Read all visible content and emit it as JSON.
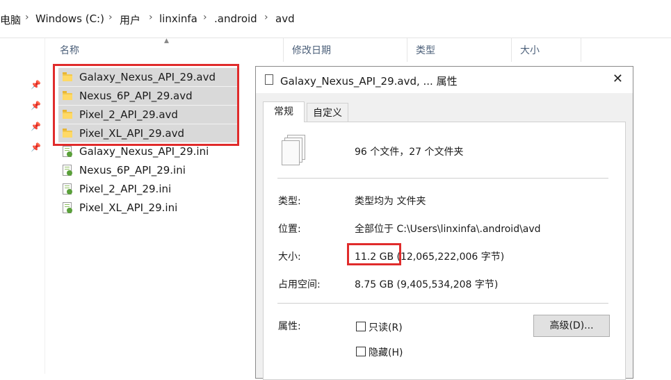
{
  "breadcrumb": [
    "电脑",
    "Windows (C:)",
    "用户",
    "linxinfa",
    ".android",
    "avd"
  ],
  "columns": {
    "name": "名称",
    "modified": "修改日期",
    "type": "类型",
    "size": "大小"
  },
  "files": [
    {
      "name": "Galaxy_Nexus_API_29.avd",
      "kind": "folder",
      "selected": true
    },
    {
      "name": "Nexus_6P_API_29.avd",
      "kind": "folder",
      "selected": true
    },
    {
      "name": "Pixel_2_API_29.avd",
      "kind": "folder",
      "selected": true
    },
    {
      "name": "Pixel_XL_API_29.avd",
      "kind": "folder",
      "selected": true
    },
    {
      "name": "Galaxy_Nexus_API_29.ini",
      "kind": "ini",
      "selected": false
    },
    {
      "name": "Nexus_6P_API_29.ini",
      "kind": "ini",
      "selected": false
    },
    {
      "name": "Pixel_2_API_29.ini",
      "kind": "ini",
      "selected": false
    },
    {
      "name": "Pixel_XL_API_29.ini",
      "kind": "ini",
      "selected": false
    }
  ],
  "dialog": {
    "title": "Galaxy_Nexus_API_29.avd, ... 属性",
    "tabs": [
      "常规",
      "自定义"
    ],
    "summary": "96 个文件，27 个文件夹",
    "type_label": "类型:",
    "type_value": "类型均为 文件夹",
    "location_label": "位置:",
    "location_value": "全部位于 C:\\Users\\linxinfa\\.android\\avd",
    "size_label": "大小:",
    "size_value_main": "11.2 GB",
    "size_value_detail": " (12,065,222,006 字节)",
    "disk_label": "占用空间:",
    "disk_value": "8.75 GB (9,405,534,208 字节)",
    "attr_label": "属性:",
    "readonly_label": "只读(R)",
    "hidden_label": "隐藏(H)",
    "advanced_button": "高级(D)..."
  },
  "icons": {
    "pin": "pin-icon",
    "close": "close-icon",
    "folder": "folder-icon",
    "ini": "ini-file-icon"
  },
  "colors": {
    "highlight": "#e02b2b",
    "selection": "#d9d9d9"
  }
}
